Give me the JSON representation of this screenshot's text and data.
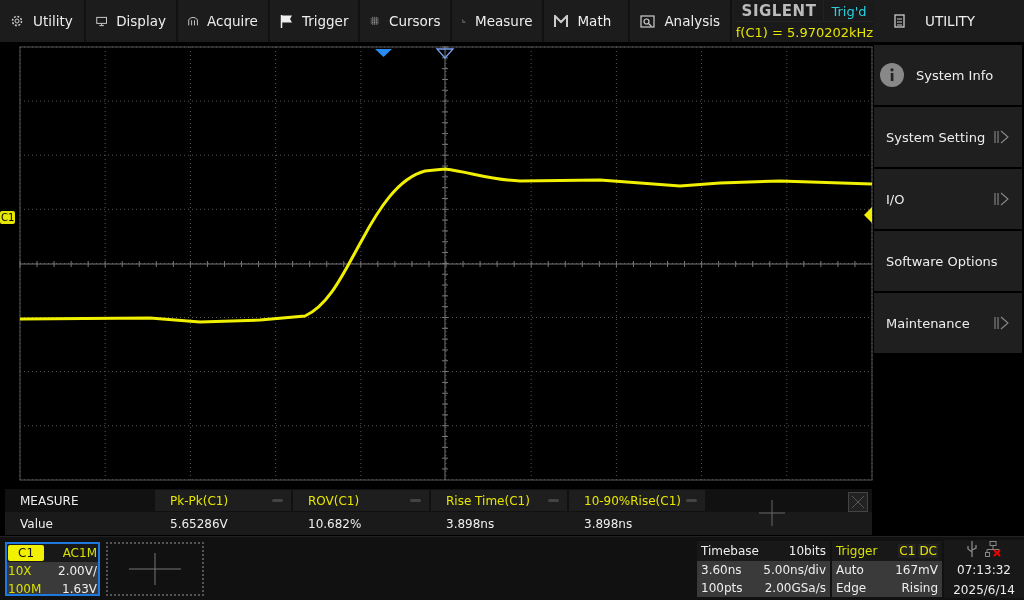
{
  "menu": [
    {
      "label": "Utility"
    },
    {
      "label": "Display"
    },
    {
      "label": "Acquire"
    },
    {
      "label": "Trigger"
    },
    {
      "label": "Cursors"
    },
    {
      "label": "Measure"
    },
    {
      "label": "Math"
    },
    {
      "label": "Analysis"
    }
  ],
  "brand": "SIGLENT",
  "trigger_status": "Trig'd",
  "frequency": "f(C1) = 5.970202kHz",
  "side_panel": {
    "title": "UTILITY",
    "items": [
      {
        "label": "System Info",
        "kind": "info"
      },
      {
        "label": "System Setting",
        "kind": "submenu"
      },
      {
        "label": "I/O",
        "kind": "submenu"
      },
      {
        "label": "Software Options",
        "kind": "plain"
      },
      {
        "label": "Maintenance",
        "kind": "submenu"
      }
    ]
  },
  "channel_marker": "C1",
  "measure": {
    "title": "MEASURE",
    "row_label": "Value",
    "items": [
      {
        "name": "Pk-Pk(C1)",
        "value": "5.65286V"
      },
      {
        "name": "ROV(C1)",
        "value": "10.682%"
      },
      {
        "name": "Rise Time(C1)",
        "value": "3.898ns"
      },
      {
        "name": "10-90%Rise(C1)",
        "value": "3.898ns"
      }
    ]
  },
  "channel": {
    "name": "C1",
    "coupling": "AC1M",
    "probe": "10X",
    "scale": "2.00V/",
    "bandwidth": "100M",
    "offset": "1.63V",
    "selected": true
  },
  "timebase": {
    "title": "Timebase",
    "bits": "10bits",
    "delay": "3.60ns",
    "scale": "5.00ns/div",
    "points": "100pts",
    "rate": "2.00GSa/s"
  },
  "trigger": {
    "title": "Trigger",
    "source": "C1",
    "coupling": "DC",
    "mode": "Auto",
    "level": "167mV",
    "type": "Edge",
    "slope": "Rising"
  },
  "clock": {
    "time": "07:13:32",
    "date": "2025/6/14"
  }
}
